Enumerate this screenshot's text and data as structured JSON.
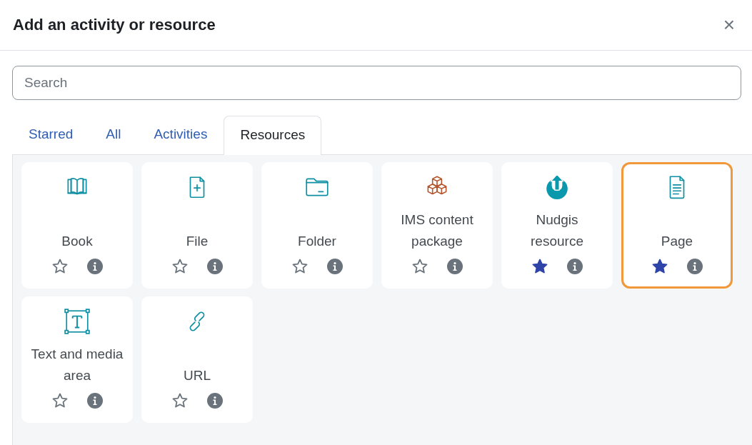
{
  "dialog": {
    "title": "Add an activity or resource",
    "close": "×"
  },
  "search": {
    "placeholder": "Search"
  },
  "tabs": [
    {
      "label": "Starred",
      "selected": false
    },
    {
      "label": "All",
      "selected": false
    },
    {
      "label": "Activities",
      "selected": false
    },
    {
      "label": "Resources",
      "selected": true
    }
  ],
  "items": [
    {
      "label": "Book",
      "kind": "book",
      "starred": false,
      "selected": false
    },
    {
      "label": "File",
      "kind": "file",
      "starred": false,
      "selected": false
    },
    {
      "label": "Folder",
      "kind": "folder",
      "starred": false,
      "selected": false
    },
    {
      "label": "IMS content package",
      "kind": "package",
      "starred": false,
      "selected": false
    },
    {
      "label": "Nudgis resource",
      "kind": "nudgis",
      "starred": true,
      "selected": false
    },
    {
      "label": "Page",
      "kind": "page",
      "starred": true,
      "selected": true
    },
    {
      "label": "Text and media area",
      "kind": "textmedia",
      "starred": false,
      "selected": false
    },
    {
      "label": "URL",
      "kind": "url",
      "starred": false,
      "selected": false
    }
  ]
}
